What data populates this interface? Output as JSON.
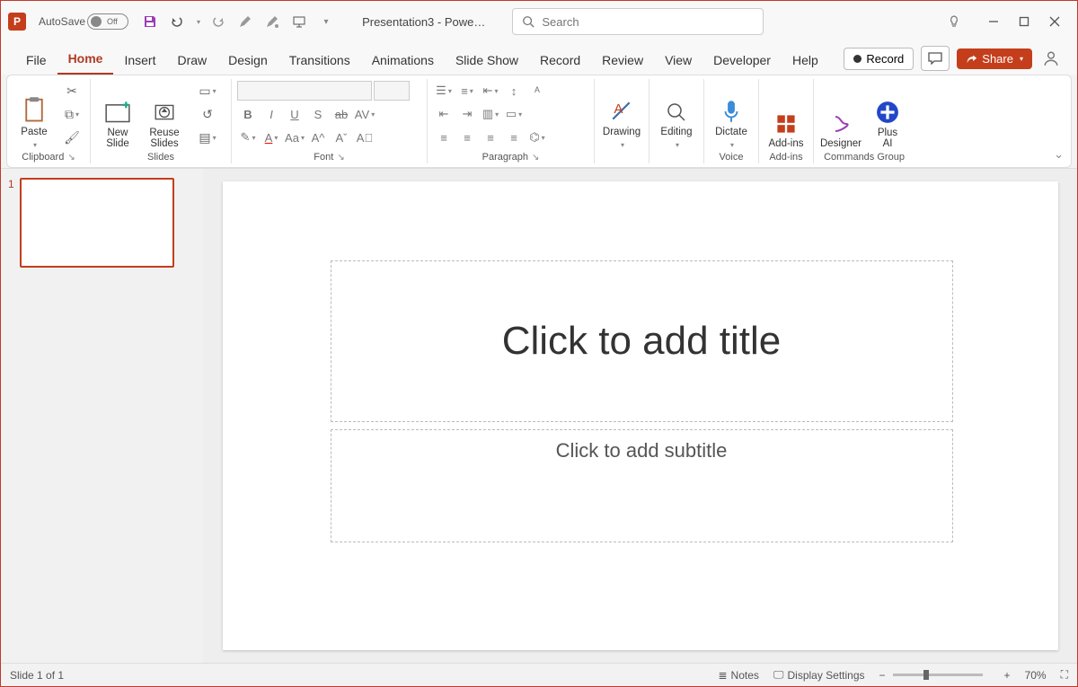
{
  "titlebar": {
    "autosave_label": "AutoSave",
    "autosave_state": "Off",
    "doc_title": "Presentation3 - Powe…",
    "search_placeholder": "Search"
  },
  "tabs": {
    "items": [
      "File",
      "Home",
      "Insert",
      "Draw",
      "Design",
      "Transitions",
      "Animations",
      "Slide Show",
      "Record",
      "Review",
      "View",
      "Developer",
      "Help"
    ],
    "active_index": 1,
    "record_label": "Record",
    "share_label": "Share"
  },
  "ribbon": {
    "clipboard": {
      "paste": "Paste",
      "label": "Clipboard"
    },
    "slides": {
      "new_slide": "New\nSlide",
      "reuse": "Reuse\nSlides",
      "label": "Slides"
    },
    "font": {
      "label": "Font"
    },
    "paragraph": {
      "label": "Paragraph"
    },
    "drawing": {
      "btn": "Drawing",
      "label": ""
    },
    "editing": {
      "btn": "Editing"
    },
    "voice": {
      "btn": "Dictate",
      "label": "Voice"
    },
    "addins": {
      "btn": "Add-ins",
      "label": "Add-ins"
    },
    "designer": {
      "btn": "Designer"
    },
    "plusai": {
      "line1": "Plus",
      "line2": "AI"
    },
    "commands_label": "Commands Group"
  },
  "slide": {
    "number": "1",
    "title_placeholder": "Click to add title",
    "subtitle_placeholder": "Click to add subtitle"
  },
  "status": {
    "slide_info": "Slide 1 of 1",
    "notes": "Notes",
    "display_settings": "Display Settings",
    "zoom": "70%"
  }
}
